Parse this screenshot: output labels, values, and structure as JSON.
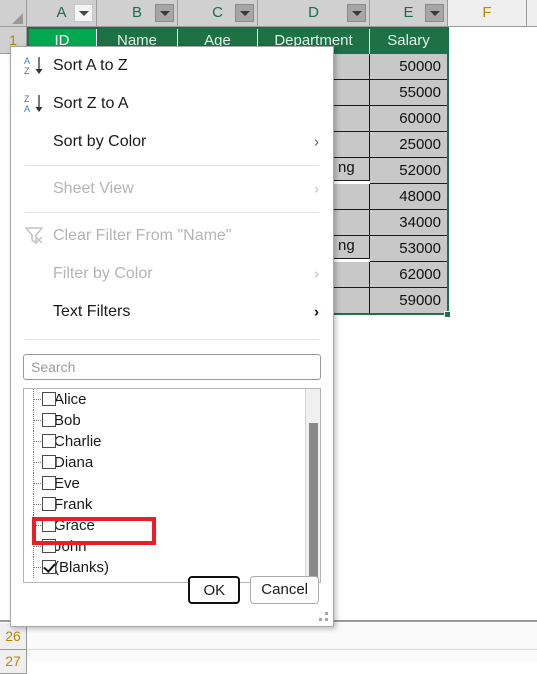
{
  "spreadsheet": {
    "column_headers": [
      "A",
      "B",
      "C",
      "D",
      "E",
      "F"
    ],
    "row_headers": [
      "1",
      "26",
      "27"
    ],
    "table_headers": [
      "ID",
      "Name",
      "Age",
      "Department",
      "Salary"
    ],
    "active_header": "ID",
    "visible_partial_cells": [
      "ng",
      "ng"
    ],
    "salary_values": [
      "50000",
      "55000",
      "60000",
      "25000",
      "52000",
      "48000",
      "34000",
      "53000",
      "62000",
      "59000"
    ],
    "selection_accent": "#1e7145",
    "header_fill": "#1e7145",
    "active_cell_fill": "#00a850"
  },
  "filter_menu": {
    "items": [
      {
        "label": "Sort A to Z",
        "accel": "S",
        "icon": "sort-ascending-icon",
        "disabled": false,
        "submenu": false
      },
      {
        "label": "Sort Z to A",
        "accel": "o",
        "icon": "sort-descending-icon",
        "disabled": false,
        "submenu": false
      },
      {
        "label": "Sort by Color",
        "accel": "t",
        "icon": "",
        "disabled": false,
        "submenu": true
      },
      {
        "label": "Sheet View",
        "accel": "V",
        "icon": "",
        "disabled": true,
        "submenu": true
      },
      {
        "label": "Clear Filter From \"Name\"",
        "accel": "C",
        "icon": "clear-filter-icon",
        "disabled": true,
        "submenu": false
      },
      {
        "label": "Filter by Color",
        "accel": "I",
        "icon": "",
        "disabled": true,
        "submenu": true
      },
      {
        "label": "Text Filters",
        "accel": "F",
        "icon": "",
        "disabled": false,
        "submenu": true
      }
    ],
    "search": {
      "value": "",
      "placeholder": "Search"
    },
    "list_items": [
      {
        "label": "Alice",
        "checked": false
      },
      {
        "label": "Bob",
        "checked": false
      },
      {
        "label": "Charlie",
        "checked": false
      },
      {
        "label": "Diana",
        "checked": false
      },
      {
        "label": "Eve",
        "checked": false
      },
      {
        "label": "Frank",
        "checked": false
      },
      {
        "label": "Grace",
        "checked": false
      },
      {
        "label": "John",
        "checked": false
      },
      {
        "label": "(Blanks)",
        "checked": true
      }
    ],
    "highlighted_item": "(Blanks)",
    "highlight_color": "#ee1c25",
    "buttons": {
      "ok": "OK",
      "cancel": "Cancel"
    }
  }
}
